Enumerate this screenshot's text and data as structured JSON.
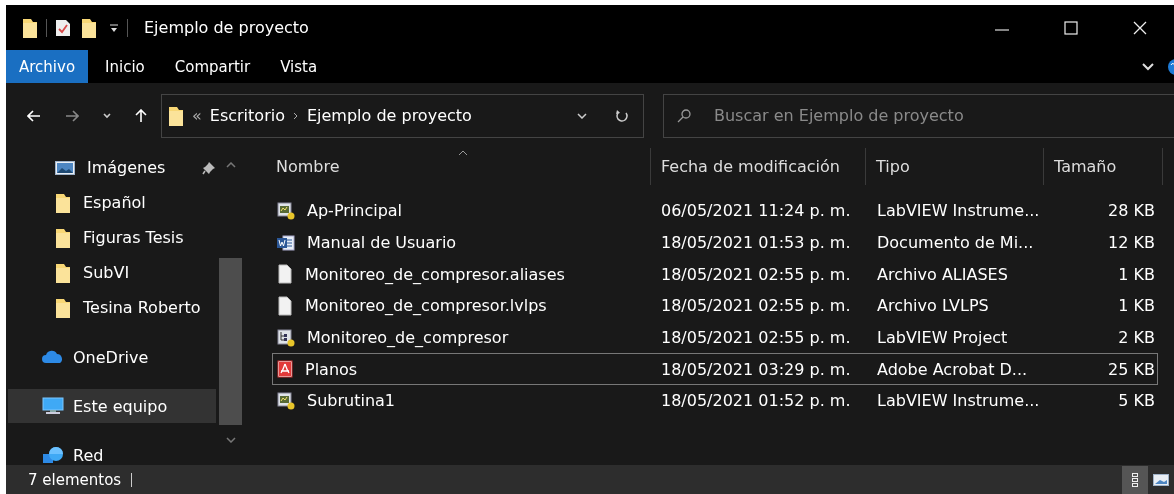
{
  "window": {
    "title": "Ejemplo de proyecto"
  },
  "ribbon_tabs": [
    {
      "label": "Archivo",
      "selected": true
    },
    {
      "label": "Inicio",
      "selected": false
    },
    {
      "label": "Compartir",
      "selected": false
    },
    {
      "label": "Vista",
      "selected": false
    }
  ],
  "address": {
    "overflow_marker": "«",
    "path": [
      "Escritorio",
      "Ejemplo de proyecto"
    ]
  },
  "search": {
    "placeholder": "Buscar en Ejemplo de proyecto"
  },
  "sidebar": {
    "items": [
      {
        "label": "Imágenes",
        "kind": "pictures",
        "pinned": true,
        "selected": false
      },
      {
        "label": "Español",
        "kind": "folder",
        "pinned": false,
        "selected": false
      },
      {
        "label": "Figuras Tesis",
        "kind": "folder",
        "pinned": false,
        "selected": false
      },
      {
        "label": "SubVI",
        "kind": "folder",
        "pinned": false,
        "selected": false
      },
      {
        "label": "Tesina Roberto",
        "kind": "folder",
        "pinned": false,
        "selected": false
      },
      {
        "label": "OneDrive",
        "kind": "cloud",
        "pinned": false,
        "selected": false
      },
      {
        "label": "Este equipo",
        "kind": "computer",
        "pinned": false,
        "selected": true
      },
      {
        "label": "Red",
        "kind": "network",
        "pinned": false,
        "selected": false
      }
    ]
  },
  "table": {
    "columns": [
      "Nombre",
      "Fecha de modificación",
      "Tipo",
      "Tamaño"
    ],
    "rows": [
      {
        "name": "Ap-Principal",
        "kind": "labview-vi",
        "modified": "06/05/2021 11:24 p. m.",
        "type": "LabVIEW Instrume...",
        "size": "28 KB",
        "focused": false
      },
      {
        "name": "Manual de Usuario",
        "kind": "word",
        "modified": "18/05/2021 01:53 p. m.",
        "type": "Documento de Mi...",
        "size": "12 KB",
        "focused": false
      },
      {
        "name": "Monitoreo_de_compresor.aliases",
        "kind": "blank",
        "modified": "18/05/2021 02:55 p. m.",
        "type": "Archivo ALIASES",
        "size": "1 KB",
        "focused": false
      },
      {
        "name": "Monitoreo_de_compresor.lvlps",
        "kind": "blank",
        "modified": "18/05/2021 02:55 p. m.",
        "type": "Archivo LVLPS",
        "size": "1 KB",
        "focused": false
      },
      {
        "name": "Monitoreo_de_compresor",
        "kind": "labview-project",
        "modified": "18/05/2021 02:55 p. m.",
        "type": "LabVIEW Project",
        "size": "2 KB",
        "focused": false
      },
      {
        "name": "Planos",
        "kind": "pdf",
        "modified": "18/05/2021 03:29 p. m.",
        "type": "Adobe Acrobat D...",
        "size": "25 KB",
        "focused": true
      },
      {
        "name": "Subrutina1",
        "kind": "labview-vi",
        "modified": "18/05/2021 01:52 p. m.",
        "type": "LabVIEW Instrume...",
        "size": "5 KB",
        "focused": false
      }
    ]
  },
  "status_bar": {
    "item_count": "7 elementos"
  }
}
